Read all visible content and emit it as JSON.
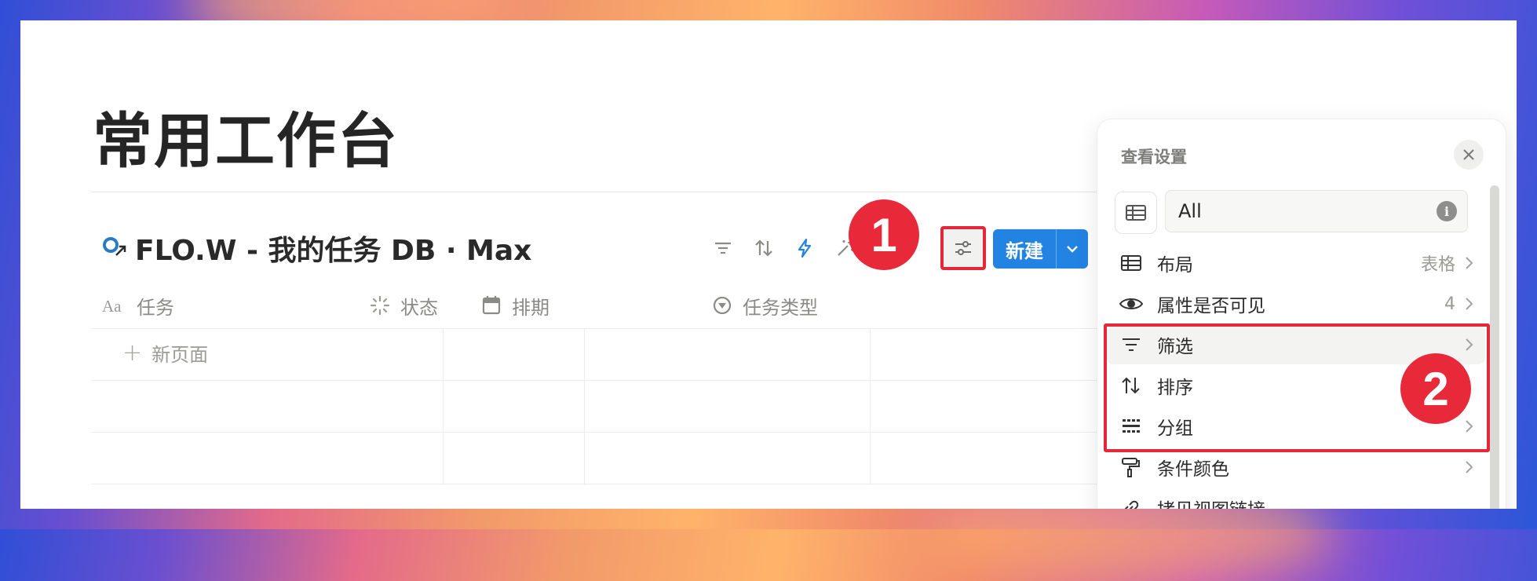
{
  "page": {
    "title": "常用工作台"
  },
  "database": {
    "title": "FLO.W - 我的任务 DB · Max",
    "icon": "flow-logo-icon",
    "new_button_label": "新建",
    "toolbar_icons": [
      "filter-icon",
      "sort-icon",
      "automation-lightning-icon",
      "ai-sparkle-icon",
      "view-settings-icon"
    ]
  },
  "table": {
    "columns": [
      {
        "label": "任务",
        "icon": "title-aa-icon"
      },
      {
        "label": "状态",
        "icon": "status-spinner-icon"
      },
      {
        "label": "排期",
        "icon": "calendar-icon"
      },
      {
        "label": "任务类型",
        "icon": "select-circle-icon"
      }
    ],
    "new_page_label": "新页面"
  },
  "annotations": {
    "step1": "1",
    "step2": "2",
    "highlight_color": "#e5273a"
  },
  "settings_panel": {
    "title": "查看设置",
    "view_name": "All",
    "items": [
      {
        "label": "布局",
        "value": "表格",
        "icon": "table-layout-icon"
      },
      {
        "label": "属性是否可见",
        "value": "4",
        "icon": "eye-icon"
      },
      {
        "label": "筛选",
        "value": "",
        "icon": "filter-icon"
      },
      {
        "label": "排序",
        "value": "",
        "icon": "sort-icon"
      },
      {
        "label": "分组",
        "value": "",
        "icon": "group-icon"
      },
      {
        "label": "条件颜色",
        "value": "",
        "icon": "paint-roller-icon"
      },
      {
        "label": "拷贝视图链接",
        "value": "",
        "icon": "link-icon"
      }
    ]
  },
  "colors": {
    "accent": "#2383e2",
    "badge": "#e8293a",
    "text": "#252525"
  }
}
